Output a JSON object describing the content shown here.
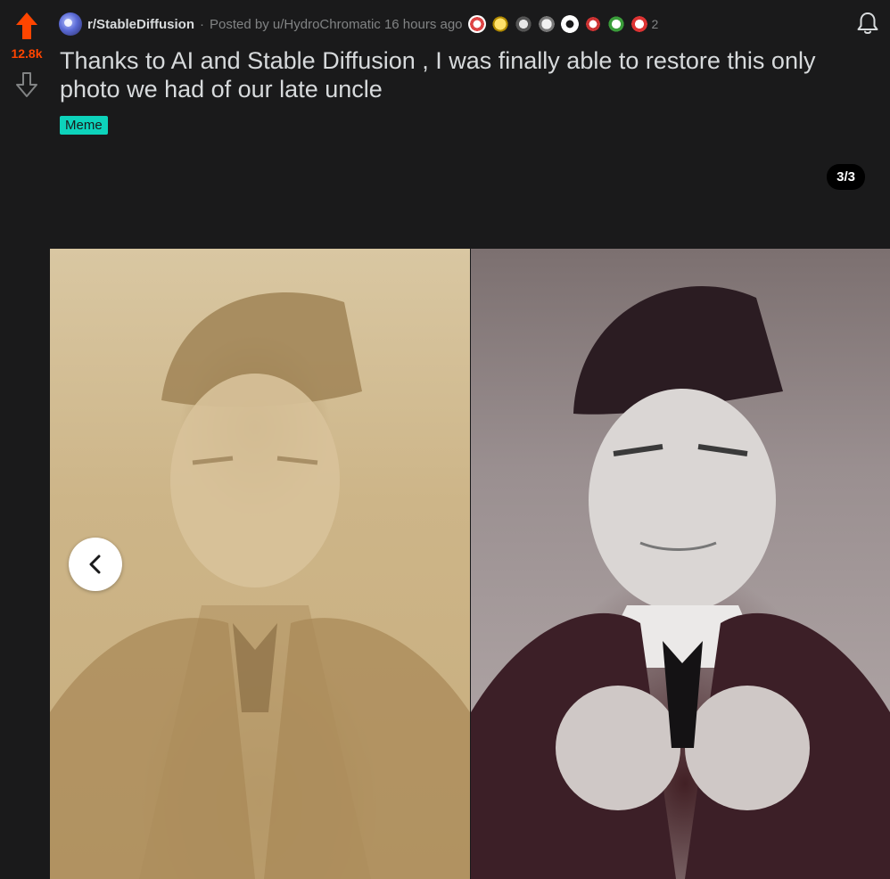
{
  "post": {
    "score": "12.8k",
    "subreddit": "r/StableDiffusion",
    "separator": "·",
    "posted_by_prefix": "Posted by",
    "author": "u/HydroChromatic",
    "time_ago": "16 hours ago",
    "awards_extra_count": "2",
    "title": "Thanks to AI and Stable Diffusion , I was finally able to restore this only photo we had of our late uncle",
    "flair": "Meme"
  },
  "gallery": {
    "counter": "3/3"
  },
  "colors": {
    "upvote": "#ff4500",
    "flair_bg": "#0dd3bb",
    "background": "#1a1a1b"
  },
  "icons": {
    "upvote": "arrow-up-icon",
    "downvote": "arrow-down-icon",
    "bell": "bell-icon",
    "prev": "chevron-left-icon"
  }
}
